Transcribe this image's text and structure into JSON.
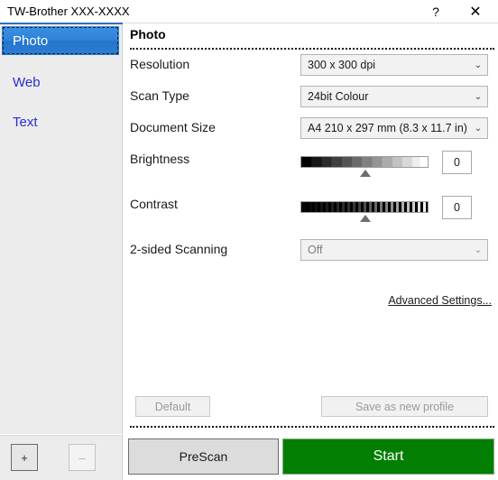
{
  "window": {
    "title": "TW-Brother XXX-XXXX",
    "help_icon": "help-icon",
    "help_glyph": "?",
    "close_icon": "close-icon",
    "close_glyph": "✕"
  },
  "sidebar": {
    "items": [
      {
        "label": "Photo",
        "selected": true
      },
      {
        "label": "Web",
        "selected": false
      },
      {
        "label": "Text",
        "selected": false
      }
    ],
    "add_label": "+",
    "remove_label": "–"
  },
  "panel": {
    "title": "Photo",
    "rows": [
      {
        "label": "Resolution",
        "value": "300 x 300 dpi",
        "enabled": true
      },
      {
        "label": "Scan Type",
        "value": "24bit Colour",
        "enabled": true
      },
      {
        "label": "Document Size",
        "value": "A4 210 x 297 mm (8.3 x 11.7 in)",
        "enabled": true
      },
      {
        "label": "2-sided Scanning",
        "value": "Off",
        "enabled": false
      }
    ],
    "brightness": {
      "label": "Brightness",
      "value": "0"
    },
    "contrast": {
      "label": "Contrast",
      "value": "0"
    },
    "advanced_link": "Advanced Settings...",
    "default_button": "Default",
    "save_profile_button": "Save as new profile",
    "chevron_glyph": "⌄"
  },
  "actions": {
    "prescan_label": "PreScan",
    "start_label": "Start",
    "start_color": "#027e02"
  }
}
